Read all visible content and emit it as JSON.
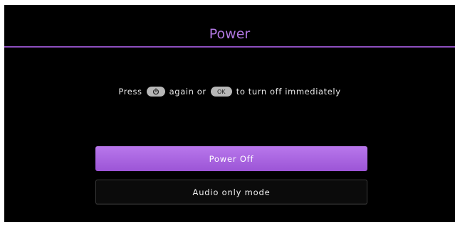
{
  "dialog": {
    "title": "Power",
    "instruction": {
      "prefix": "Press",
      "power_key_icon": "power-icon",
      "middle": "again or",
      "ok_key_label": "OK",
      "suffix": "to turn off immediately"
    },
    "buttons": {
      "power_off": "Power Off",
      "audio_only": "Audio only mode"
    }
  },
  "colors": {
    "background": "#000000",
    "accent": "#b077e0",
    "divider": "#8d4ebf",
    "selected_button": "#a963e2",
    "key_badge": "#b7b7b7"
  }
}
